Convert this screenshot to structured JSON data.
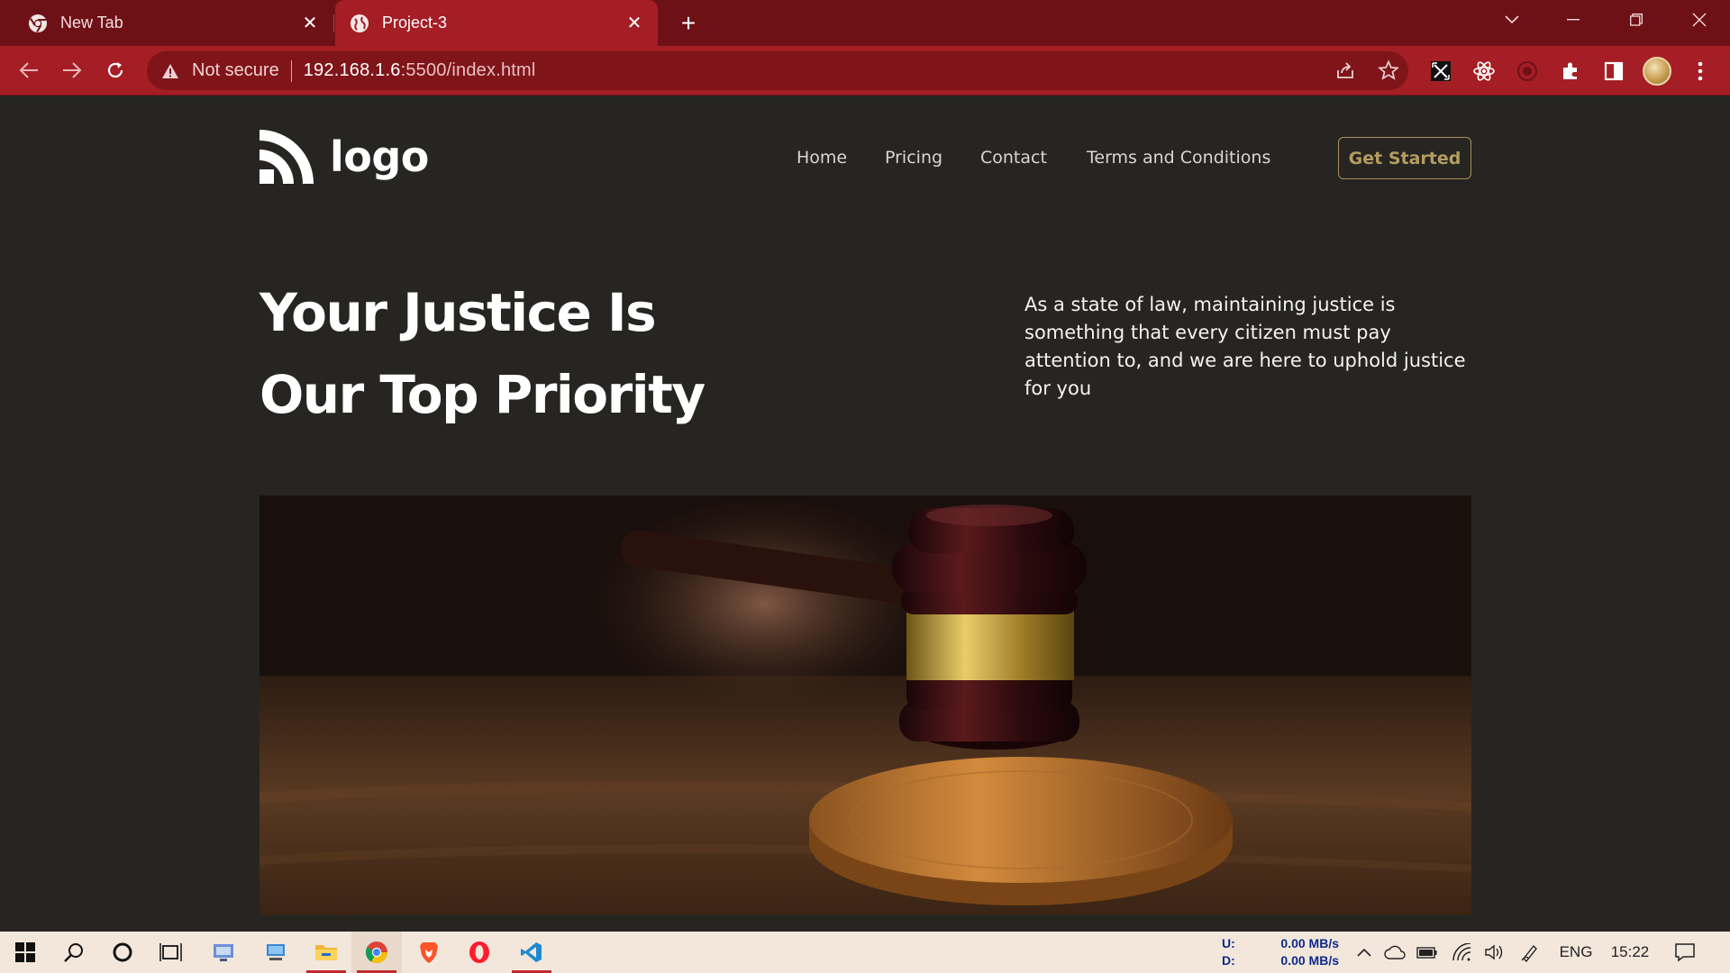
{
  "browser": {
    "tabs": [
      {
        "title": "New Tab",
        "active": false
      },
      {
        "title": "Project-3",
        "active": true
      }
    ],
    "address": {
      "security_label": "Not secure",
      "url_host": "192.168.1.6",
      "url_rest": ":5500/index.html"
    }
  },
  "site": {
    "logo_text": "logo",
    "nav": [
      "Home",
      "Pricing",
      "Contact",
      "Terms and Conditions"
    ],
    "cta_label": "Get Started",
    "hero": {
      "title_line1": "Your Justice Is",
      "title_line2": "Our Top Priority",
      "description": "As a state of law, maintaining justice is something that every citizen must pay attention to, and we are here to uphold justice for you"
    },
    "hero_image": "gavel-on-sound-block"
  },
  "taskbar": {
    "net_up_label": "U:",
    "net_down_label": "D:",
    "net_up": "0.00 MB/s",
    "net_down": "0.00 MB/s",
    "lang": "ENG",
    "time": "15:22"
  },
  "colors": {
    "tabstrip": "#6e1116",
    "toolbar": "#a51d25",
    "page_bg": "#262522",
    "cta_accent": "#b59d5f",
    "taskbar": "#f3e7dc"
  }
}
